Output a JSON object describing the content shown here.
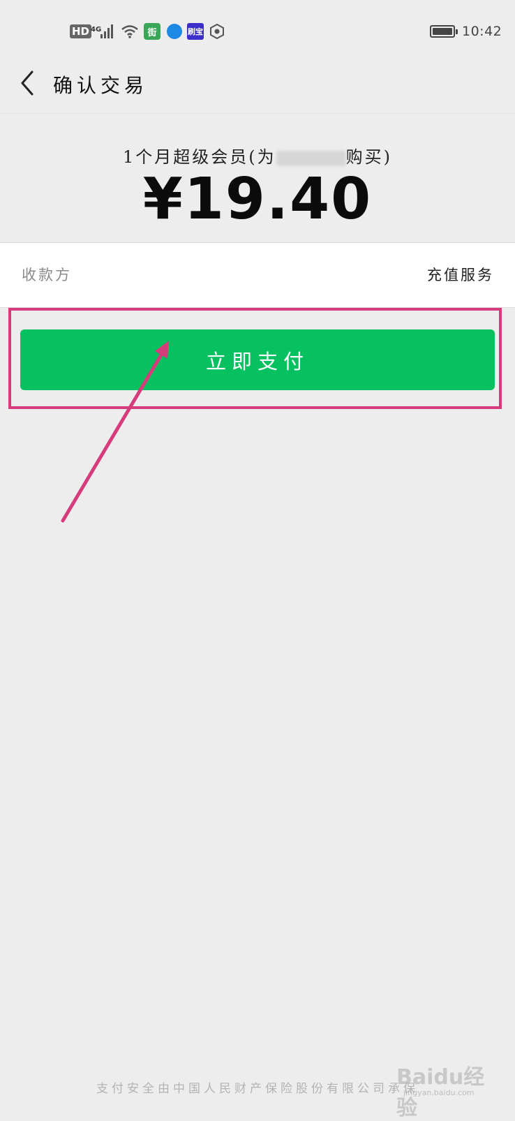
{
  "status_bar": {
    "hd_label": "HD",
    "network_label": "4G",
    "app1_label": "街",
    "app3_label": "刷宝",
    "time": "10:42"
  },
  "nav": {
    "title": "确认交易"
  },
  "order": {
    "product_prefix": "1个月超级会员(为",
    "product_suffix": "购买)",
    "amount": "¥19.40"
  },
  "payee": {
    "label": "收款方",
    "value": "充值服务"
  },
  "pay_button": {
    "label": "立即支付"
  },
  "footer": {
    "note": "支付安全由中国人民财产保险股份有限公司承保"
  },
  "watermark": {
    "brand": "Baidu经验",
    "url": "jingyan.baidu.com"
  },
  "colors": {
    "primary_green": "#07c160",
    "highlight_pink": "#d63c7c",
    "background": "#ededed"
  }
}
